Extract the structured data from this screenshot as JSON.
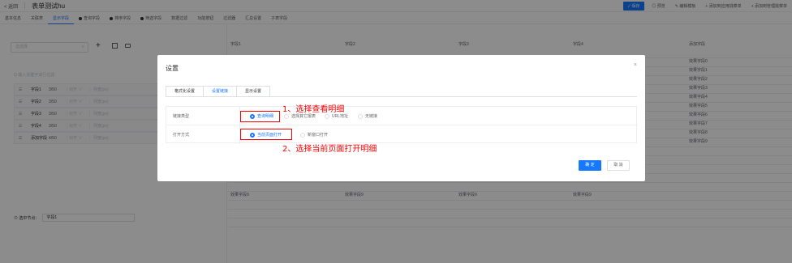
{
  "topbar": {
    "back": "< 返回",
    "title": "表单测试hu",
    "actions": [
      "✓ 保存",
      "◎ 预览",
      "✎ 编辑模板",
      "+ 添加到应用挑菜单",
      "+ 添加到管理挑菜单"
    ]
  },
  "tabs": [
    {
      "label": "基本信息",
      "active": false,
      "dot": false
    },
    {
      "label": "关联表",
      "active": false,
      "dot": false
    },
    {
      "label": "显示字段",
      "active": true,
      "dot": false
    },
    {
      "label": "查询字段",
      "active": false,
      "dot": true
    },
    {
      "label": "排序字段",
      "active": false,
      "dot": true
    },
    {
      "label": "筛选字段",
      "active": false,
      "dot": true
    },
    {
      "label": "数据过滤",
      "active": false,
      "dot": false
    },
    {
      "label": "功能按钮",
      "active": false,
      "dot": false
    },
    {
      "label": "过滤器",
      "active": false,
      "dot": false
    },
    {
      "label": "汇总设置",
      "active": false,
      "dot": false
    },
    {
      "label": "子表字段",
      "active": false,
      "dot": false
    }
  ],
  "left": {
    "select_placeholder": "选选择",
    "search_placeholder": "Q 输入关键字进行过滤",
    "fields": [
      {
        "name": "字段1",
        "count": "3/50",
        "align": "对齐 ∨",
        "width": "列宽(px)"
      },
      {
        "name": "字段2",
        "count": "3/50",
        "align": "对齐 ∨",
        "width": "列宽(px)"
      },
      {
        "name": "字段3",
        "count": "3/50",
        "align": "对齐 ∨",
        "width": "列宽(px)"
      },
      {
        "name": "字段4",
        "count": "3/50",
        "align": "对齐 ∨",
        "width": "列宽(px)"
      },
      {
        "name": "添加字段",
        "count": "4/50",
        "align": "对齐 ∨",
        "width": "列宽(px)"
      }
    ],
    "node_label": "⊙ 选中节点：",
    "node_value": "字段1"
  },
  "grid": {
    "headers": [
      "字段1",
      "字段2",
      "字段3",
      "字段4",
      "添加字段"
    ],
    "right_col": [
      "效果字段0",
      "效果字段1",
      "效果字段2",
      "效果字段3",
      "效果字段4",
      "效果字段5",
      "效果字段6",
      "效果字段7",
      "效果字段8",
      "效果字段9"
    ],
    "last_row": [
      "效果字段9",
      "效果字段9",
      "效果字段9",
      "效果字段9",
      "效果字段9"
    ]
  },
  "modal": {
    "title": "设置",
    "close": "×",
    "tabs": [
      {
        "label": "格式化设置",
        "active": false
      },
      {
        "label": "设置链接",
        "active": true
      },
      {
        "label": "显示设置",
        "active": false
      }
    ],
    "link_type_label": "链接类型",
    "link_type_options": [
      {
        "label": "查询明细",
        "selected": true
      },
      {
        "label": "选择其它报表",
        "selected": false
      },
      {
        "label": "URL地址",
        "selected": false
      },
      {
        "label": "无链接",
        "selected": false
      }
    ],
    "open_mode_label": "打开方式",
    "open_mode_options": [
      {
        "label": "当前页面打开",
        "selected": true
      },
      {
        "label": "新窗口打开",
        "selected": false
      }
    ],
    "ok": "确 定",
    "cancel": "取 消"
  },
  "annotations": {
    "step1": "1、选择查看明细",
    "step2": "2、选择当前页面打开明细"
  },
  "colors": {
    "accent": "#1677ff",
    "annotation": "#ff0000"
  }
}
